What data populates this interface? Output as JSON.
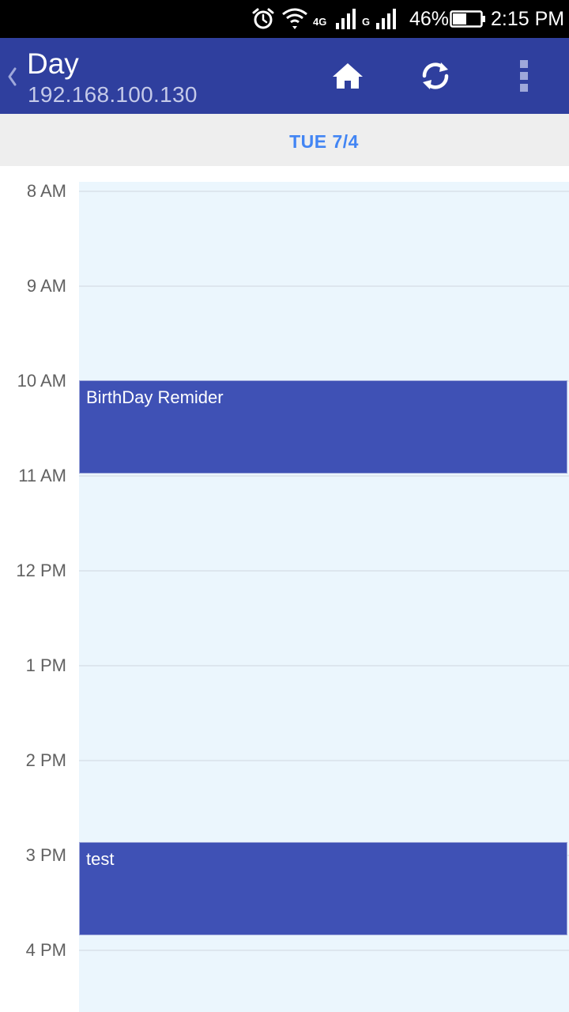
{
  "status_bar": {
    "network_label": "4G",
    "network2_label": "G",
    "battery_percent": "46%",
    "time": "2:15 PM",
    "icons": [
      "alarm-icon",
      "wifi-icon",
      "signal-icon",
      "signal-icon",
      "battery-icon"
    ]
  },
  "app_bar": {
    "title": "Day",
    "subtitle": "192.168.100.130",
    "icons": [
      "back-chevron-icon",
      "home-icon",
      "sync-icon",
      "overflow-menu-icon"
    ],
    "color": "#2f3f9e"
  },
  "date_header": {
    "label": "TUE 7/4",
    "color": "#4285f4"
  },
  "hours": [
    "8 AM",
    "9 AM",
    "10 AM",
    "11 AM",
    "12 PM",
    "1 PM",
    "2 PM",
    "3 PM",
    "4 PM"
  ],
  "events": [
    {
      "title": "BirthDay Remider",
      "start": "10 AM",
      "end": "11 AM"
    },
    {
      "title": "test",
      "start": "3 PM",
      "end": "4 PM"
    }
  ],
  "event_color": "#3f51b5"
}
